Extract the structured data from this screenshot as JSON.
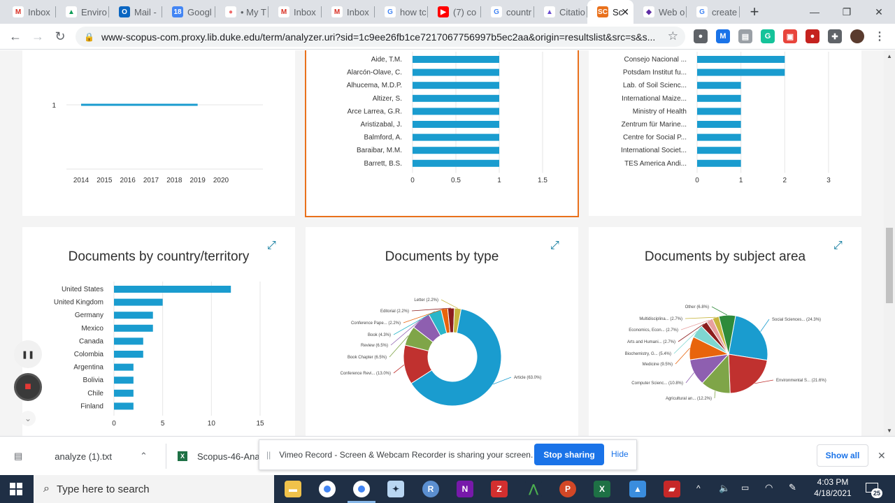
{
  "browser": {
    "tabs": [
      {
        "label": "Inbox",
        "fav_color": "#ffffff",
        "fav_text": "M",
        "fav_text_color": "#d93025"
      },
      {
        "label": "Enviro",
        "fav_color": "#ffffff",
        "fav_text": "▲",
        "fav_text_color": "#0f9d58"
      },
      {
        "label": "Mail -",
        "fav_color": "#0a66c2",
        "fav_text": "O",
        "fav_text_color": "#ffffff"
      },
      {
        "label": "Googl",
        "fav_color": "#4285f4",
        "fav_text": "18",
        "fav_text_color": "#ffffff"
      },
      {
        "label": "• My T",
        "fav_color": "#ffffff",
        "fav_text": "●",
        "fav_text_color": "#f06a6a"
      },
      {
        "label": "Inbox",
        "fav_color": "#ffffff",
        "fav_text": "M",
        "fav_text_color": "#d93025"
      },
      {
        "label": "Inbox",
        "fav_color": "#ffffff",
        "fav_text": "M",
        "fav_text_color": "#d93025"
      },
      {
        "label": "how tc",
        "fav_color": "#ffffff",
        "fav_text": "G",
        "fav_text_color": "#4285f4"
      },
      {
        "label": "(7) co",
        "fav_color": "#ff0000",
        "fav_text": "▶",
        "fav_text_color": "#ffffff"
      },
      {
        "label": "countr",
        "fav_color": "#ffffff",
        "fav_text": "G",
        "fav_text_color": "#4285f4"
      },
      {
        "label": "Citatio",
        "fav_color": "#ffffff",
        "fav_text": "▲",
        "fav_text_color": "#6a4cd0"
      },
      {
        "label": "Sc",
        "fav_color": "#e9711c",
        "fav_text": "SC",
        "fav_text_color": "#ffffff",
        "active": true
      },
      {
        "label": "Web o",
        "fav_color": "#ffffff",
        "fav_text": "◆",
        "fav_text_color": "#5e2ca5"
      },
      {
        "label": "create",
        "fav_color": "#ffffff",
        "fav_text": "G",
        "fav_text_color": "#4285f4"
      }
    ],
    "active_tab_close": "✕",
    "new_tab": "+",
    "window_controls": {
      "minimize": "—",
      "restore": "❐",
      "close": "✕"
    },
    "url": "www-scopus-com.proxy.lib.duke.edu/term/analyzer.uri?sid=1c9ee26fb1ce7217067756997b5ec2aa&origin=resultslist&src=s&s...",
    "nav": {
      "back": "←",
      "forward": "→",
      "reload": "↻"
    },
    "bookmark_icon": "☆",
    "extensions": [
      {
        "name": "ext-circle-icon",
        "color": "#5f6368",
        "text": "●"
      },
      {
        "name": "ext-m-icon",
        "color": "#1a73e8",
        "text": "M"
      },
      {
        "name": "ext-doc-icon",
        "color": "#9aa0a6",
        "text": "▤"
      },
      {
        "name": "ext-grammarly-icon",
        "color": "#15c39a",
        "text": "G"
      },
      {
        "name": "ext-capture-icon",
        "color": "#e8453c",
        "text": "▣"
      },
      {
        "name": "ext-record-icon",
        "color": "#c5221f",
        "text": "●"
      },
      {
        "name": "ext-puzzle-icon",
        "color": "#5f6368",
        "text": "✚"
      },
      {
        "name": "profile-avatar",
        "color": "#5a3b2e",
        "text": ""
      },
      {
        "name": "menu-icon",
        "color": "#ffffff",
        "text": "⋮"
      }
    ]
  },
  "line_chart": {
    "chart_data": {
      "type": "line",
      "x": [
        2014,
        2015,
        2016,
        2017,
        2018,
        2019,
        2020
      ],
      "x_ticks": [
        "2014",
        "2015",
        "2016",
        "2017",
        "2018",
        "2019",
        "2020"
      ],
      "y_ticks": [
        "1"
      ],
      "series": [
        {
          "x": [
            2014,
            2019
          ],
          "values": [
            1,
            1
          ]
        }
      ],
      "color": "#1a9ccf"
    }
  },
  "author_chart": {
    "chart_data": {
      "type": "bar",
      "orientation": "horizontal",
      "categories": [
        "Aide, T.M.",
        "Alarcón-Olave, C.",
        "Alhucema, M.D.P.",
        "Altizer, S.",
        "Arce Larrea, G.R.",
        "Aristizabal, J.",
        "Balmford, A.",
        "Baraibar, M.M.",
        "Barrett, B.S."
      ],
      "values": [
        1,
        1,
        1,
        1,
        1,
        1,
        1,
        1,
        1
      ],
      "x_ticks": [
        "0",
        "0.5",
        "1",
        "1.5"
      ],
      "xlim": [
        0,
        1.5
      ],
      "color": "#1a9ccf"
    }
  },
  "affiliation_chart": {
    "chart_data": {
      "type": "bar",
      "orientation": "horizontal",
      "categories": [
        "Consejo Nacional ...",
        "Potsdam Institut fu...",
        "Lab. of Soil Scienc...",
        "International Maize...",
        "Ministry of Health",
        "Zentrum für Marine...",
        "Centre for Social P...",
        "International Societ...",
        "TES America Andi..."
      ],
      "values": [
        2,
        2,
        1,
        1,
        1,
        1,
        1,
        1,
        1
      ],
      "x_ticks": [
        "0",
        "1",
        "2",
        "3"
      ],
      "xlim": [
        0,
        3
      ],
      "color": "#1a9ccf"
    }
  },
  "country_chart": {
    "chart_data": {
      "type": "bar",
      "orientation": "horizontal",
      "title": "Documents by country/territory",
      "categories": [
        "United States",
        "United Kingdom",
        "Germany",
        "Mexico",
        "Canada",
        "Colombia",
        "Argentina",
        "Bolivia",
        "Chile",
        "Finland"
      ],
      "values": [
        12,
        5,
        4,
        4,
        3,
        3,
        2,
        2,
        2,
        2
      ],
      "x_ticks": [
        "0",
        "5",
        "10",
        "15"
      ],
      "xlim": [
        0,
        15
      ],
      "color": "#1a9ccf"
    }
  },
  "type_chart": {
    "chart_data": {
      "type": "pie",
      "donut": true,
      "title": "Documents by type",
      "slices": [
        {
          "label": "Article (63.0%)",
          "value": 63.0,
          "color": "#1a9ccf"
        },
        {
          "label": "Conference Revi... (13.0%)",
          "value": 13.0,
          "color": "#c0312f"
        },
        {
          "label": "Book Chapter (6.5%)",
          "value": 6.5,
          "color": "#7fa548"
        },
        {
          "label": "Review (6.5%)",
          "value": 6.5,
          "color": "#8e5fb0"
        },
        {
          "label": "Book (4.3%)",
          "value": 4.3,
          "color": "#2bb6c9"
        },
        {
          "label": "Conference Pape... (2.2%)",
          "value": 2.2,
          "color": "#e8640c"
        },
        {
          "label": "Editorial (2.2%)",
          "value": 2.2,
          "color": "#8c1d1d"
        },
        {
          "label": "Letter (2.2%)",
          "value": 2.2,
          "color": "#c7b53e"
        }
      ]
    }
  },
  "subject_chart": {
    "chart_data": {
      "type": "pie",
      "title": "Documents by subject area",
      "slices": [
        {
          "label": "Social Sciences... (24.3%)",
          "value": 24.3,
          "color": "#1a9ccf"
        },
        {
          "label": "Environmental S... (21.6%)",
          "value": 21.6,
          "color": "#c0312f"
        },
        {
          "label": "Agricultural an... (12.2%)",
          "value": 12.2,
          "color": "#7fa548"
        },
        {
          "label": "Computer Scienc... (10.8%)",
          "value": 10.8,
          "color": "#8e5fb0"
        },
        {
          "label": "Medicine (9.5%)",
          "value": 9.5,
          "color": "#e8640c"
        },
        {
          "label": "Biochemistry, G... (5.4%)",
          "value": 5.4,
          "color": "#7fd6d0"
        },
        {
          "label": "Arts and Humani... (2.7%)",
          "value": 2.7,
          "color": "#8c1d1d"
        },
        {
          "label": "Economics, Econ... (2.7%)",
          "value": 2.7,
          "color": "#e8a0a0"
        },
        {
          "label": "Multidisciplina... (2.7%)",
          "value": 2.7,
          "color": "#c7b53e"
        },
        {
          "label": "Other (6.8%)",
          "value": 6.8,
          "color": "#2e8b3a"
        }
      ]
    }
  },
  "recorder": {
    "pause_icon": "❚❚",
    "stop_icon": "■",
    "collapse_icon": "⌄"
  },
  "downloads": {
    "items": [
      {
        "name": "analyze (1).txt",
        "icon": "▤"
      },
      {
        "name": "Scopus-46-Anal",
        "icon": "X"
      }
    ],
    "caret": "⌃",
    "show_all": "Show all",
    "close": "✕"
  },
  "share_bar": {
    "handle": "||",
    "message": "Vimeo Record - Screen & Webcam Recorder is sharing your screen.",
    "stop_label": "Stop sharing",
    "hide_label": "Hide"
  },
  "taskbar": {
    "search_placeholder": "Type here to search",
    "time": "4:03 PM",
    "date": "4/18/2021",
    "notification_count": "25"
  }
}
